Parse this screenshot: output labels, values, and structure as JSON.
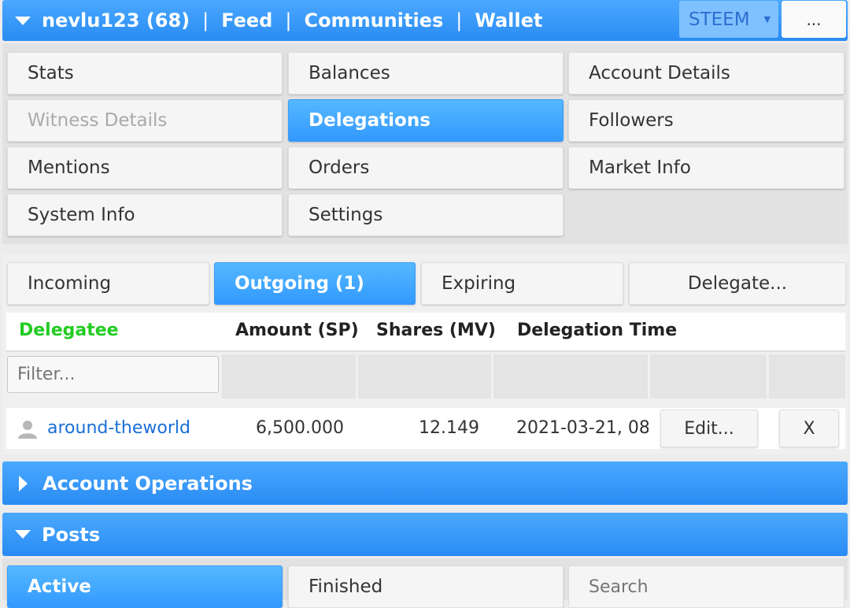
{
  "header": {
    "user": "nevlu123 (68)",
    "sep": "|",
    "links": [
      "Feed",
      "Communities",
      "Wallet"
    ],
    "currency": "STEEM",
    "more": "..."
  },
  "menu": {
    "items": [
      {
        "label": "Stats",
        "state": "normal"
      },
      {
        "label": "Balances",
        "state": "normal"
      },
      {
        "label": "Account Details",
        "state": "normal"
      },
      {
        "label": "Witness Details",
        "state": "disabled"
      },
      {
        "label": "Delegations",
        "state": "active"
      },
      {
        "label": "Followers",
        "state": "normal"
      },
      {
        "label": "Mentions",
        "state": "normal"
      },
      {
        "label": "Orders",
        "state": "normal"
      },
      {
        "label": "Market Info",
        "state": "normal"
      },
      {
        "label": "System Info",
        "state": "normal"
      },
      {
        "label": "Settings",
        "state": "normal"
      }
    ]
  },
  "delegation_tabs": {
    "incoming": "Incoming",
    "outgoing": "Outgoing (1)",
    "expiring": "Expiring",
    "delegate": "Delegate..."
  },
  "table": {
    "headers": [
      "Delegatee",
      "Amount (SP)",
      "Shares (MV)",
      "Delegation Time"
    ],
    "filter_placeholder": "Filter...",
    "rows": [
      {
        "delegatee": "around-theworld",
        "amount": "6,500.000",
        "shares": "12.149",
        "time": "2021-03-21, 08:",
        "edit": "Edit...",
        "remove": "X"
      }
    ]
  },
  "sections": {
    "account_operations": "Account Operations",
    "posts": "Posts"
  },
  "posts_tabs": {
    "active": "Active",
    "finished": "Finished",
    "search_placeholder": "Search"
  },
  "colors": {
    "accent": "#2a8cf3",
    "delegatee_header": "#22cc22",
    "link": "#1a6fd6"
  }
}
